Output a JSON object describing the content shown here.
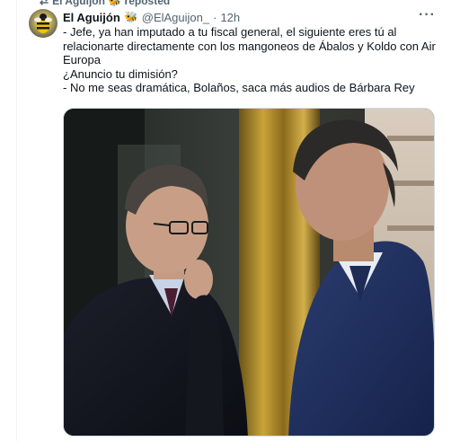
{
  "repost": {
    "label": "El Aguijón 🐝 reposted",
    "icon": "repost-icon"
  },
  "tweet": {
    "author_name": "El Aguijón",
    "author_emoji": "🐝",
    "handle": "@ElAguijon_",
    "separator": "·",
    "time": "12h",
    "more_icon": "more-icon",
    "text_lines": [
      "- Jefe, ya han imputado a tu fiscal general, el siguiente eres tú al",
      "relacionarte directamente con los mangoneos de Ábalos y Koldo con Air",
      "Europa",
      "¿Anuncio tu dimisión?",
      "- No me seas dramática, Bolaños, saca más audios de Bárbara Rey"
    ],
    "media": {
      "kind": "photo",
      "icon": "photo-image"
    }
  },
  "colors": {
    "text": "#0f1419",
    "secondary": "#536471",
    "border": "#cfd9de"
  }
}
